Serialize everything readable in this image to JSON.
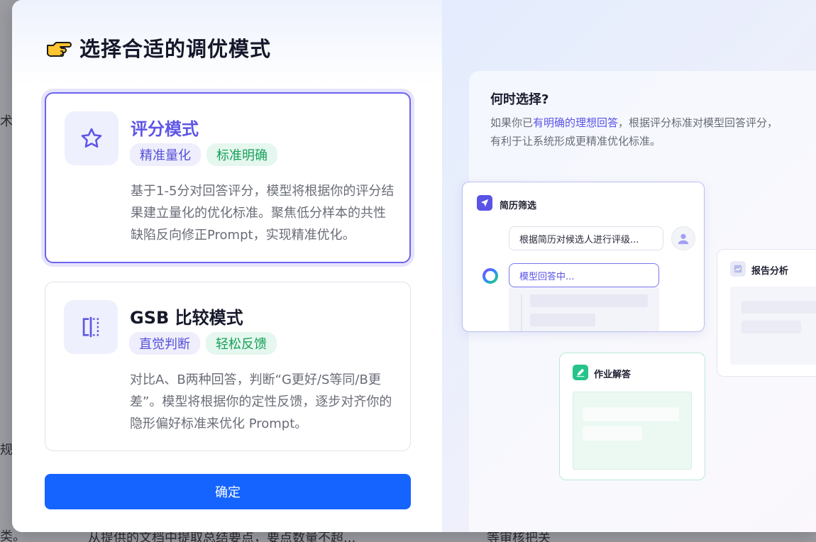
{
  "background": {
    "frag_top": "术",
    "frag_mid": "规",
    "frag_bottom_left": "类。",
    "frag_bottom_center": "从提供的文档中提取总结要点，要点数量不超...",
    "frag_bottom_right": "等审核把关"
  },
  "modal": {
    "title": "选择合适的调优模式",
    "modes": [
      {
        "title": "评分模式",
        "tags": [
          "精准量化",
          "标准明确"
        ],
        "description": "基于1-5分对回答评分，模型将根据你的评分结果建立量化的优化标准。聚焦低分样本的共性缺陷反向修正Prompt，实现精准优化。",
        "selected": true,
        "icon": "star-icon"
      },
      {
        "title": "GSB 比较模式",
        "tags": [
          "直觉判断",
          "轻松反馈"
        ],
        "description": "对比A、B两种回答，判断“G更好/S等同/B更差”。模型将根据你的定性反馈，逐步对齐你的隐形偏好标准来优化 Prompt。",
        "selected": false,
        "icon": "compare-icon"
      }
    ],
    "confirm_label": "确定"
  },
  "preview": {
    "when_title": "何时选择?",
    "when_desc_prefix": "如果你已",
    "when_desc_highlight": "有明确的理想回答",
    "when_desc_suffix": "，根据评分标准对模型回答评分，有利于让系统形成更精准优化标准。",
    "cards": {
      "resume": {
        "title": "简历筛选",
        "user_message": "根据简历对候选人进行评级...",
        "model_message": "模型回答中..."
      },
      "report": {
        "title": "报告分析"
      },
      "homework": {
        "title": "作业解答"
      }
    }
  },
  "colors": {
    "accent": "#6c63f0",
    "primary_button": "#1664ff",
    "tag_green": "#18a05a"
  }
}
